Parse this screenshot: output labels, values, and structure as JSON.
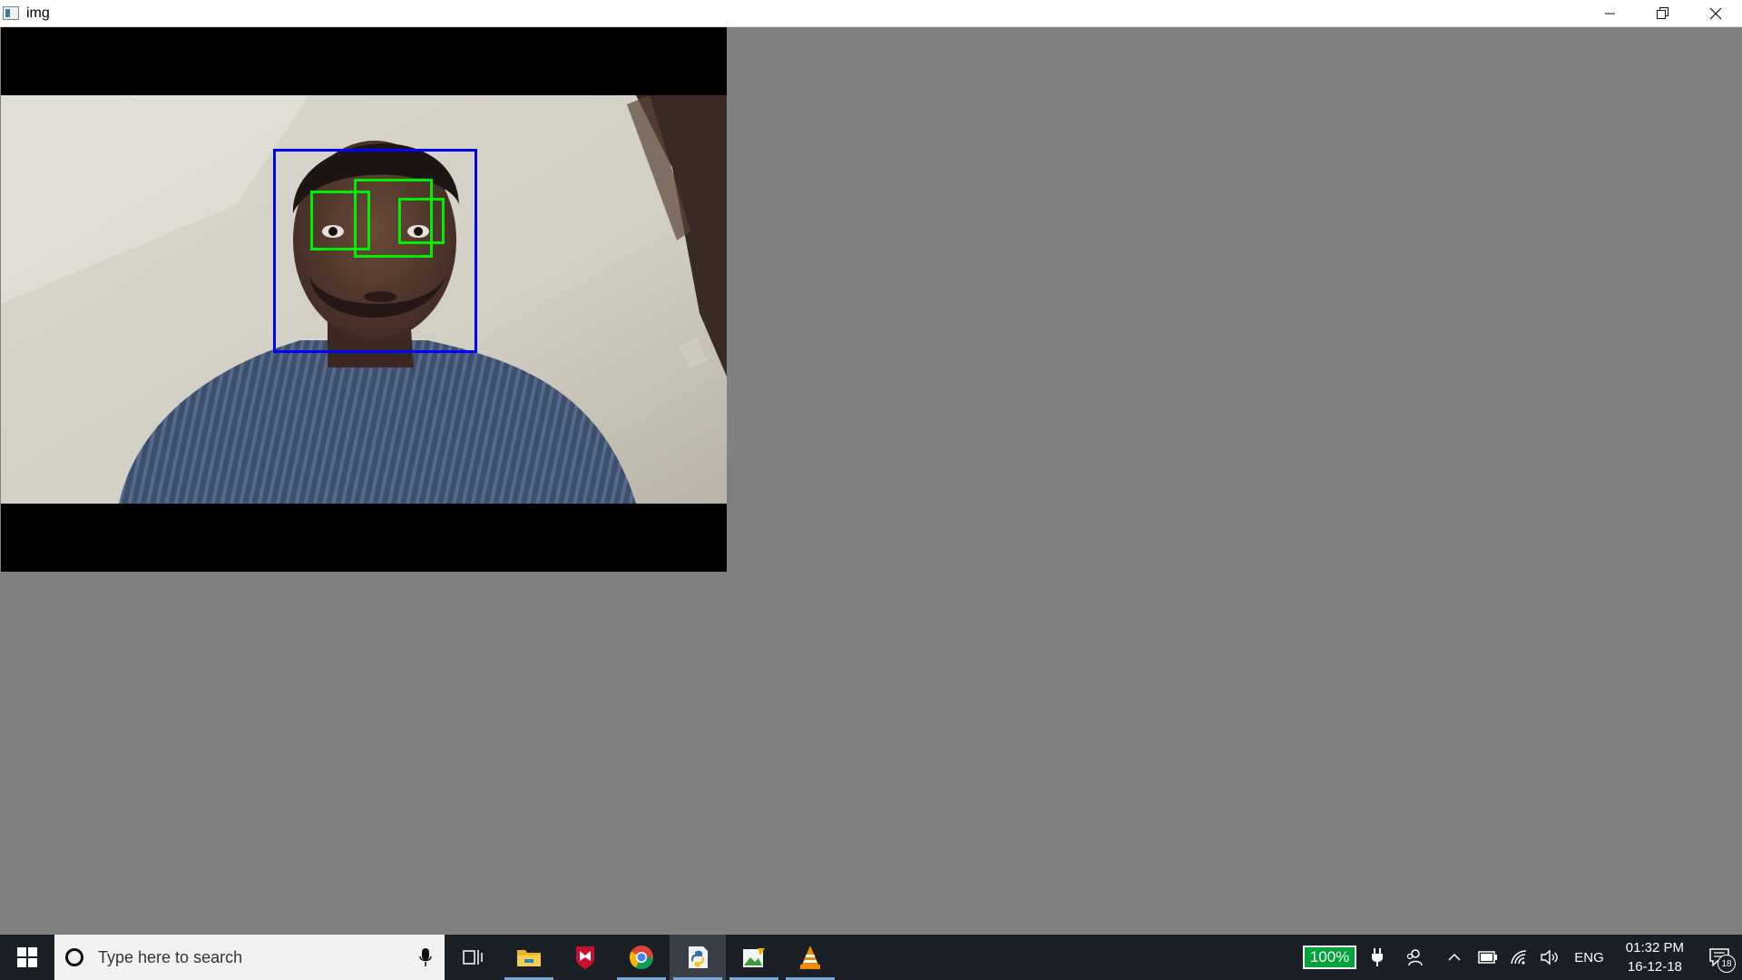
{
  "window": {
    "title": "img",
    "controls": {
      "minimize": "minimize-icon",
      "restore": "restore-icon",
      "close": "close-icon"
    }
  },
  "canvas": {
    "background": "#808080",
    "detections": [
      {
        "label": "face",
        "color": "#0000ff"
      },
      {
        "label": "eye",
        "color": "#00ee00"
      },
      {
        "label": "eye",
        "color": "#00ee00"
      },
      {
        "label": "eye",
        "color": "#00ee00"
      }
    ]
  },
  "taskbar": {
    "search": {
      "placeholder": "Type here to search"
    },
    "apps": [
      {
        "name": "task-view-icon",
        "running": false
      },
      {
        "name": "file-explorer-icon",
        "running": true
      },
      {
        "name": "mcafee-icon",
        "running": false
      },
      {
        "name": "chrome-icon",
        "running": true
      },
      {
        "name": "python-icon",
        "running": true,
        "active": true
      },
      {
        "name": "image-viewer-icon",
        "running": true
      },
      {
        "name": "vlc-icon",
        "running": true
      }
    ],
    "tray": {
      "battery_percent": "100%",
      "language": "ENG",
      "time": "01:32 PM",
      "date": "16-12-18",
      "notification_count": "18"
    }
  }
}
